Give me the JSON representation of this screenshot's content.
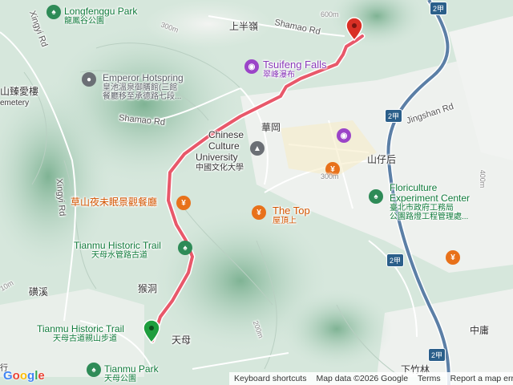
{
  "map": {
    "places": {
      "longfenggu_en": "Longfenggu Park",
      "longfenggu_zh": "龍鳳谷公園",
      "emperor_en": "Emperor Hotspring",
      "emperor_zh1": "皇池溫泉御膳館(三館",
      "emperor_zh2": "餐廳移至承德路七段...",
      "tsuifeng_en": "Tsuifeng Falls",
      "tsuifeng_zh": "翠峰瀑布",
      "chinese_culture_en1": "Chinese",
      "chinese_culture_en2": "Culture",
      "chinese_culture_en3": "University",
      "chinese_culture_zh": "中國文化大學",
      "caoshan_zh": "草山夜未眠景觀餐廳",
      "the_top_en": "The Top",
      "the_top_zh": "屋頂上",
      "tianmu_trail_en": "Tianmu Historic Trail",
      "tianmu_trail_zh": "天母水管路古道",
      "tianmu_trail2_en": "Tianmu Historic Trail",
      "tianmu_trail2_zh": "天母古道親山步道",
      "tianmu_park_en": "Tianmu Park",
      "tianmu_park_zh": "天母公園",
      "floriculture_en1": "Floriculture",
      "floriculture_en2": "Experiment Center",
      "floriculture_zh1": "臺北市政府工務局",
      "floriculture_zh2": "公園路燈工程管理處...",
      "shanbanling": "上半嶺",
      "huagang": "華岡",
      "shanzaihou": "山仔后",
      "houdong": "猴洞",
      "tianmu": "天母",
      "guangxi": "磺溪",
      "zhongyong": "中庸",
      "xiazilin": "下竹林",
      "zhenai_zh": "山臻愛樓",
      "cemetery": "emetery",
      "edge_zh": "行"
    },
    "roads": {
      "shamao1": "Shamao Rd",
      "shamao2": "Shamao Rd",
      "jingshan": "Jingshan Rd",
      "xingyi1": "Xingyi Rd",
      "xingyi2": "Xingyi Rd"
    },
    "contours": {
      "c300a": "300m",
      "c600": "600m",
      "c300b": "300m",
      "c400": "400m",
      "c200": "200m",
      "c10": "10m"
    },
    "shields": {
      "s1": "2甲",
      "s2": "2甲",
      "s3": "2甲",
      "s4": "2甲"
    },
    "icons": {
      "park": "tree-icon",
      "hotspring": "hotspring-icon",
      "attraction": "camera-icon",
      "university": "graduation-cap-icon",
      "restaurant": "fork-knife-icon",
      "start": "green-start-marker-icon",
      "end": "red-end-marker-icon"
    },
    "colors": {
      "route": "#e8586a",
      "route_outline": "#ffffff",
      "major_road": "#5b7fa6",
      "terrain": "#cfe3d8"
    }
  },
  "attribution": {
    "logo": "Google",
    "shortcuts": "Keyboard shortcuts",
    "map_data": "Map data ©2026 Google",
    "terms": "Terms",
    "report": "Report a map error"
  }
}
